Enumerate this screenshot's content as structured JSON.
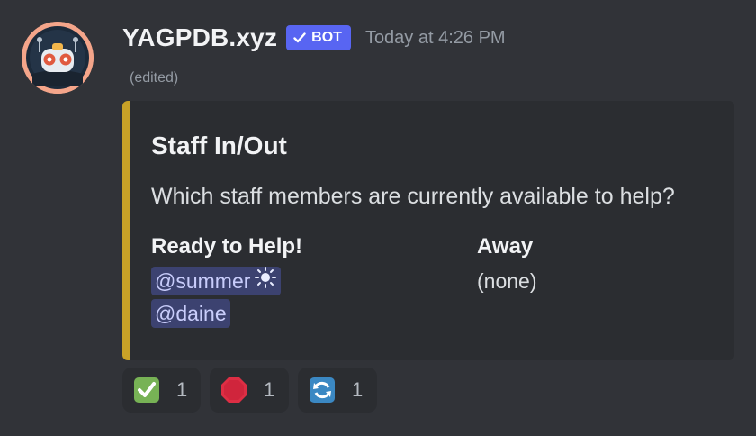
{
  "message": {
    "author": "YAGPDB.xyz",
    "bot_tag": "BOT",
    "timestamp": "Today at 4:26 PM",
    "edited": "(edited)"
  },
  "embed": {
    "accent_color": "#c9a227",
    "title": "Staff In/Out",
    "description": "Which staff members are currently available to help?",
    "fields": [
      {
        "name": "Ready to Help!",
        "mentions": [
          "@summer",
          "@daine"
        ]
      },
      {
        "name": "Away",
        "value": "(none)"
      }
    ]
  },
  "reactions": [
    {
      "emoji": "white-check-mark-icon",
      "count": "1"
    },
    {
      "emoji": "stop-sign-icon",
      "count": "1"
    },
    {
      "emoji": "arrows-counterclockwise-icon",
      "count": "1"
    }
  ],
  "colors": {
    "background": "#313338",
    "embed_bg": "#2b2d31",
    "bot_tag": "#5865f2",
    "mention_bg": "#3c4270",
    "mention_text": "#c9cdfb"
  }
}
